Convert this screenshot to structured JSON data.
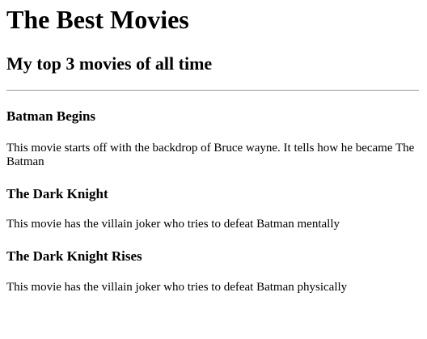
{
  "page": {
    "title": "The Best Movies",
    "subtitle": "My top 3 movies of all time"
  },
  "movies": [
    {
      "title": "Batman Begins",
      "description": "This movie starts off with the backdrop of Bruce wayne. It tells how he became The Batman"
    },
    {
      "title": "The Dark Knight",
      "description": "This movie has the villain joker who tries to defeat Batman mentally"
    },
    {
      "title": "The Dark Knight Rises",
      "description": "This movie has the villain joker who tries to defeat Batman physically"
    }
  ]
}
